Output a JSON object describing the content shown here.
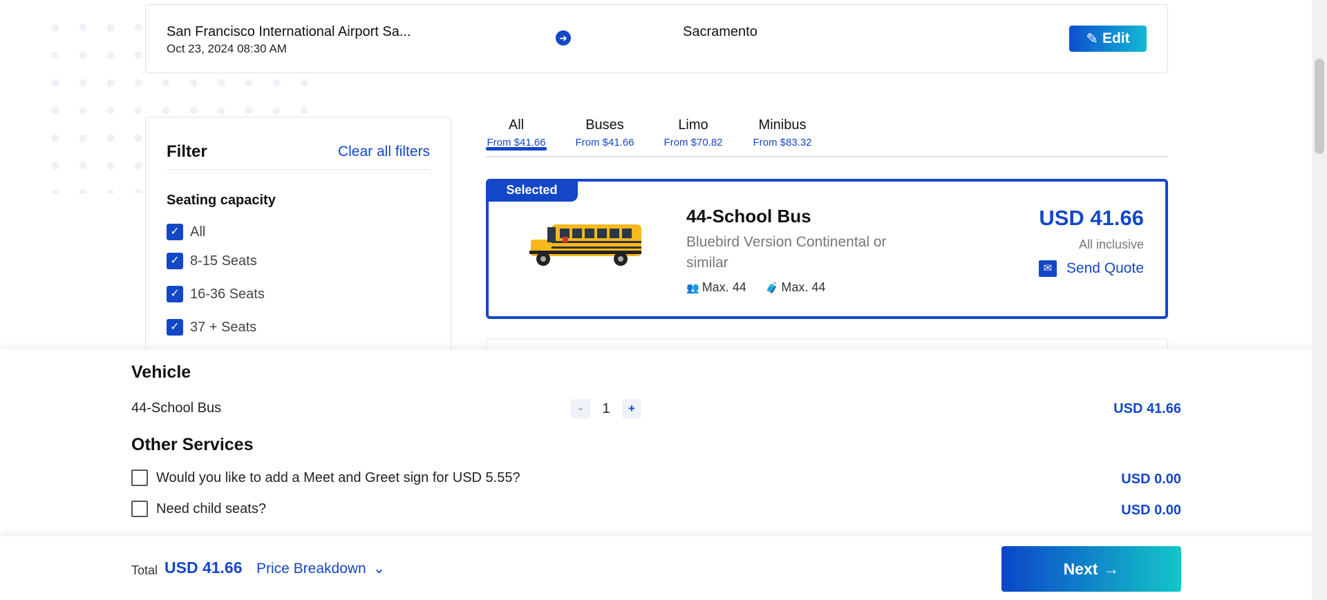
{
  "route": {
    "from": "San Francisco International Airport Sa...",
    "datetime": "Oct 23, 2024 08:30 AM",
    "to": "Sacramento",
    "edit_label": "Edit"
  },
  "filter": {
    "title": "Filter",
    "clear_label": "Clear all filters",
    "section_title": "Seating capacity",
    "options": [
      "All",
      "8-15 Seats",
      "16-36 Seats",
      "37 + Seats"
    ]
  },
  "tabs": [
    {
      "label": "All",
      "price": "From $41.66",
      "active": true
    },
    {
      "label": "Buses",
      "price": "From $41.66"
    },
    {
      "label": "Limo",
      "price": "From $70.82"
    },
    {
      "label": "Minibus",
      "price": "From $83.32"
    }
  ],
  "vehicle_card": {
    "badge": "Selected",
    "name": "44-School Bus",
    "description": "Bluebird Version Continental or similar",
    "max_passengers": "Max. 44",
    "max_luggage": "Max. 44",
    "price": "USD 41.66",
    "inclusive": "All inclusive",
    "send_quote": "Send Quote"
  },
  "summary": {
    "vehicle_title": "Vehicle",
    "vehicle_name": "44-School Bus",
    "minus": "-",
    "quantity": "1",
    "plus": "+",
    "vehicle_price": "USD 41.66",
    "services_title": "Other Services",
    "services": [
      {
        "label": "Would you like to add a Meet and Greet sign for USD 5.55?",
        "price": "USD 0.00"
      },
      {
        "label": "Need child seats?",
        "price": "USD 0.00"
      }
    ]
  },
  "footer": {
    "total_label": "Total",
    "total_value": "USD 41.66",
    "breakdown_label": "Price Breakdown",
    "next_label": "Next"
  },
  "colors": {
    "primary": "#1347c8",
    "accent_gradient_end": "#13c7c7"
  }
}
